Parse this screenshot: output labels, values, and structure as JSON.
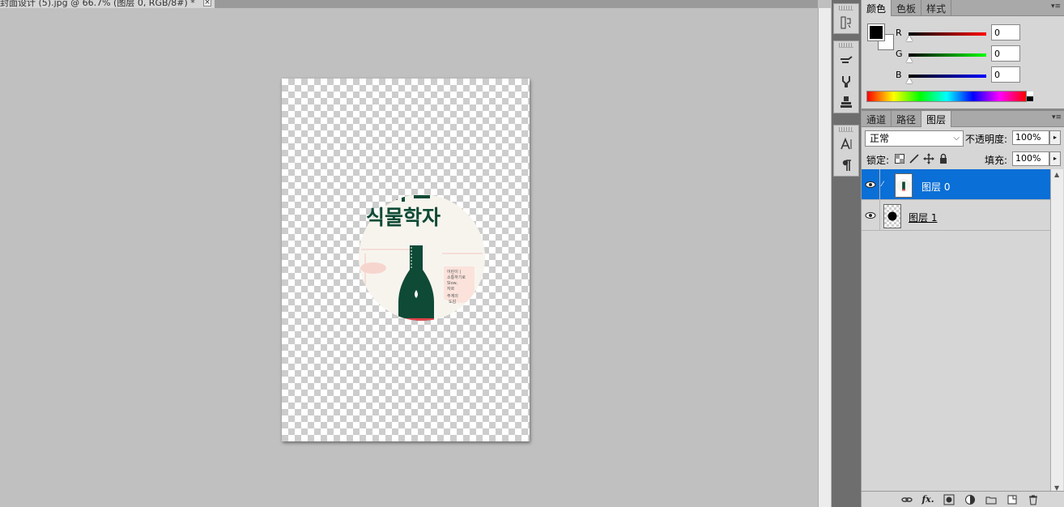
{
  "document": {
    "tab_title": "封面设计 (5).jpg @ 66.7% (图层 0, RGB/8#) *",
    "close_glyph": "×"
  },
  "canvas_art": {
    "title_line1": "식물학자",
    "label_lines": [
      "어린이 |",
      "소통하기로",
      "Slow,",
      "자르",
      "주계의",
      "도감"
    ]
  },
  "color_panel": {
    "tabs": [
      "颜色",
      "色板",
      "样式"
    ],
    "active_tab": "颜色",
    "menu_glyph": "▾≡",
    "channels": [
      {
        "label": "R",
        "value": "0",
        "color": "#ff0000"
      },
      {
        "label": "G",
        "value": "0",
        "color": "#00ff00"
      },
      {
        "label": "B",
        "value": "0",
        "color": "#0000ff"
      }
    ],
    "foreground": "#000000",
    "background": "#ffffff"
  },
  "layers_panel": {
    "tabs": [
      "通道",
      "路径",
      "图层"
    ],
    "active_tab": "图层",
    "menu_glyph": "▾≡",
    "blend_mode": "正常",
    "opacity_label": "不透明度:",
    "opacity_value": "100%",
    "lock_label": "锁定:",
    "fill_label": "填充:",
    "fill_value": "100%",
    "layers": [
      {
        "name": "图层 0",
        "selected": true,
        "visible": true
      },
      {
        "name": "图层 1",
        "selected": false,
        "visible": true
      }
    ],
    "footer_icons": [
      "link-icon",
      "fx-icon",
      "mask-icon",
      "adjustment-icon",
      "group-icon",
      "new-layer-icon",
      "trash-icon"
    ],
    "fx_text": "fx."
  },
  "colors": {
    "selection": "#0a6fd6",
    "art_green": "#0e4a36",
    "art_red": "#e5434a"
  }
}
